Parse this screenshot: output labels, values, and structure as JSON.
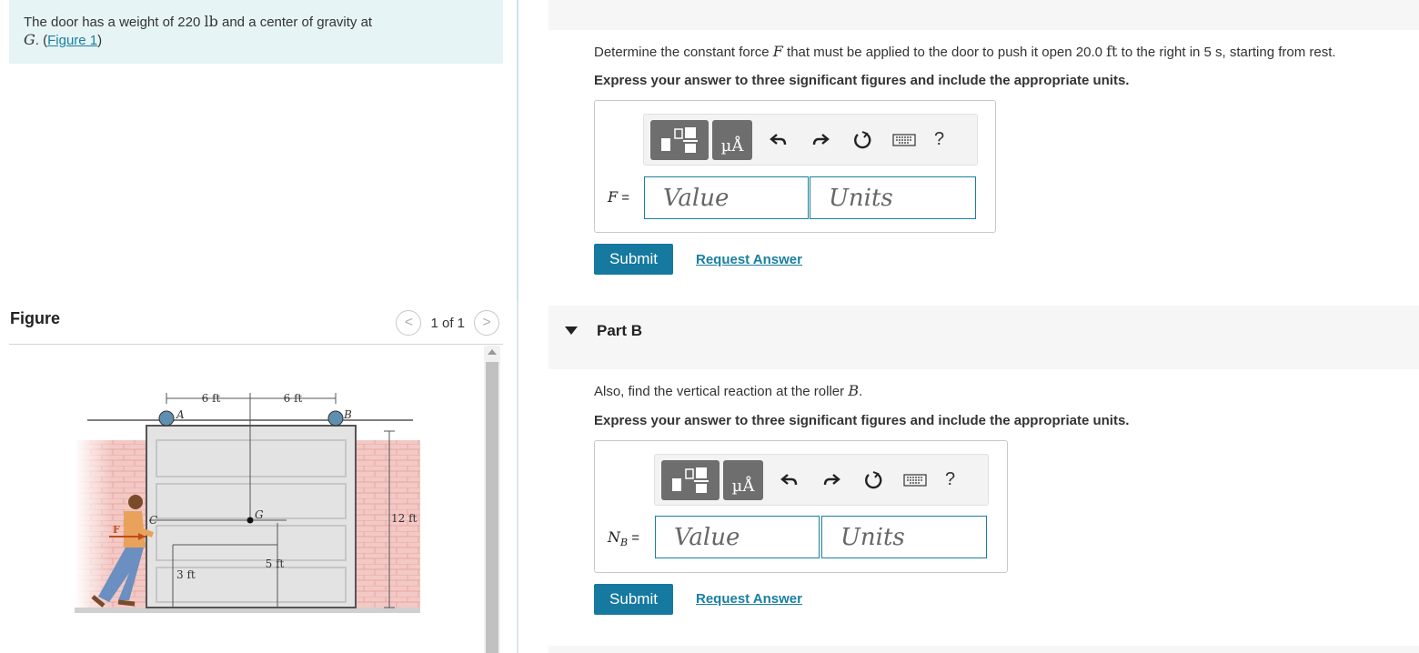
{
  "problem": {
    "text_before": "The door has a weight of 220 ",
    "weight_unit": "lb",
    "text_mid": " and a center of gravity at",
    "cg_var": "G",
    "text_after": ". (",
    "figure_link": "Figure 1",
    "text_close": ")"
  },
  "figure": {
    "title": "Figure",
    "pager": "1 of 1",
    "prev": "<",
    "next": ">",
    "labels": {
      "a": "A",
      "b": "B",
      "c": "C",
      "g": "G",
      "dim_left": "6 ft",
      "dim_right": "6 ft",
      "dim_height": "12 ft",
      "dim_5": "5 ft",
      "dim_3": "3 ft",
      "force": "F"
    }
  },
  "partA": {
    "q_before": "Determine the constant force ",
    "q_var": "F",
    "q_mid": " that must be applied to the door to push it open 20.0 ",
    "q_unit": "ft",
    "q_after": " to the right in 5 s, starting from rest.",
    "instruction": "Express your answer to three significant figures and include the appropriate units.",
    "label_var": "F",
    "label_eq": " =",
    "value_placeholder": "Value",
    "units_placeholder": "Units",
    "submit": "Submit",
    "request": "Request Answer"
  },
  "partB": {
    "title": "Part B",
    "q_before": "Also, find the vertical reaction at the roller ",
    "q_var": "B",
    "q_after": ".",
    "instruction": "Express your answer to three significant figures and include the appropriate units.",
    "label_var": "N",
    "label_sub": "B",
    "label_eq": " =",
    "value_placeholder": "Value",
    "units_placeholder": "Units",
    "submit": "Submit",
    "request": "Request Answer"
  },
  "toolbar": {
    "units_btn": "µÅ",
    "help": "?",
    "icons": [
      "undo-icon",
      "redo-icon",
      "reset-icon",
      "keyboard-icon",
      "help-icon"
    ]
  }
}
